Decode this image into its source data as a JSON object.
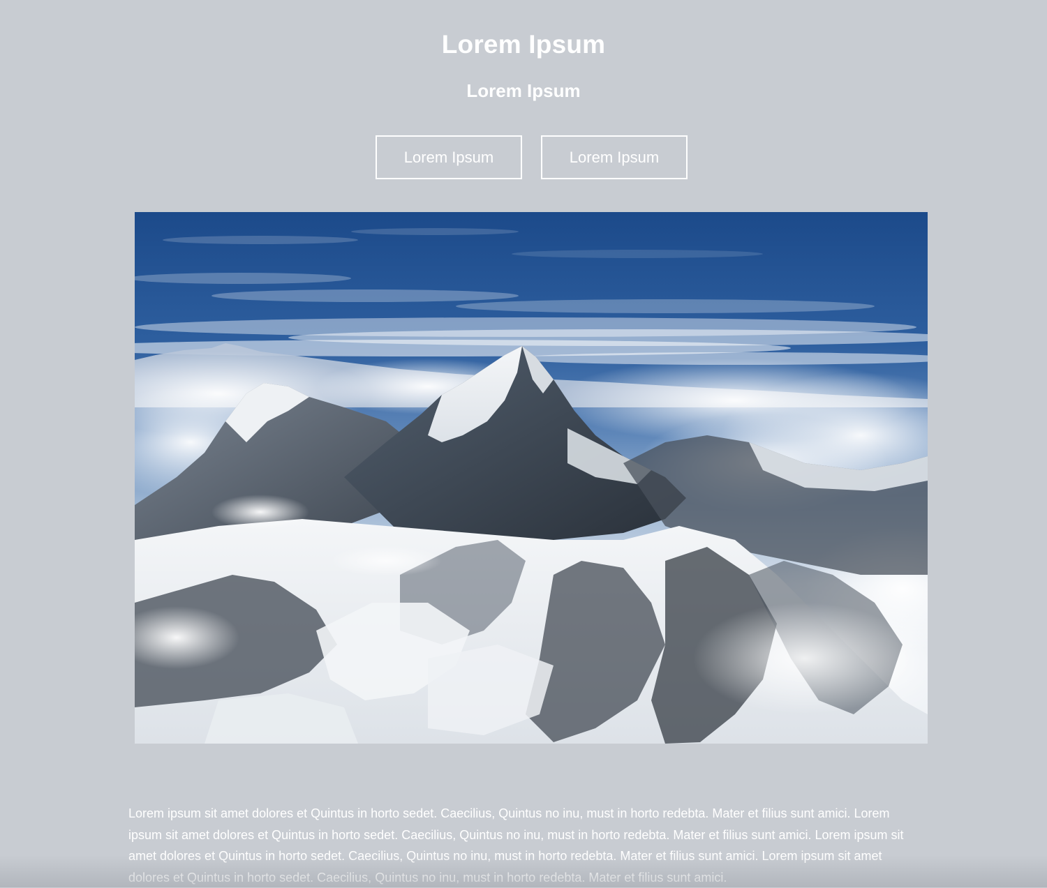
{
  "header": {
    "title": "Lorem Ipsum",
    "subtitle": "Lorem Ipsum"
  },
  "actions": {
    "primary_label": "Lorem Ipsum",
    "secondary_label": "Lorem Ipsum"
  },
  "content": {
    "paragraph": "Lorem ipsum sit amet dolores et Quintus in horto sedet. Caecilius, Quintus no inu, must in horto redebta. Mater et filius sunt amici. Lorem ipsum sit amet dolores et Quintus in horto sedet. Caecilius, Quintus no inu, must in horto redebta. Mater et filius sunt amici. Lorem ipsum sit amet dolores et Quintus in horto sedet. Caecilius, Quintus no inu, must in horto redebta. Mater et filius sunt amici. Lorem ipsum sit amet dolores et Quintus in horto sedet. Caecilius, Quintus no inu, must in horto redebta. Mater et filius sunt amici."
  },
  "colors": {
    "page_background": "#c8ccd2",
    "text": "#ffffff",
    "sky_top": "#1d4d8e",
    "sky_bottom": "#8fb0d3"
  }
}
